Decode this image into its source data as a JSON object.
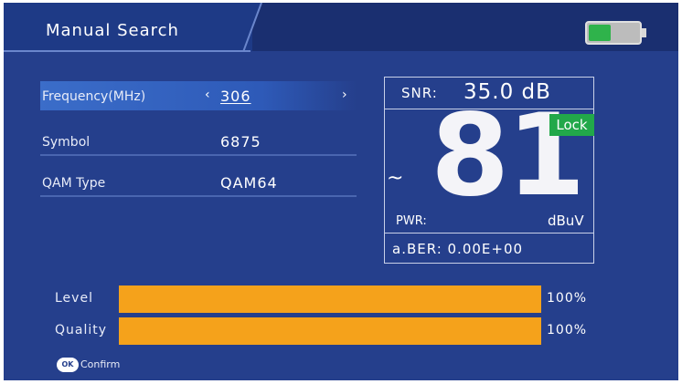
{
  "header": {
    "title": "Manual Search",
    "battery_level": 0.45,
    "battery_color": "#2fb34b"
  },
  "params": [
    {
      "label": "Frequency(MHz)",
      "value": "306",
      "left_arrow": "‹",
      "right_arrow": "›"
    },
    {
      "label": "Symbol",
      "value": "6875"
    },
    {
      "label": "QAM Type",
      "value": "QAM64"
    }
  ],
  "signal": {
    "snr_label": "SNR:",
    "snr_value": "35.0 dB",
    "lock": "Lock",
    "level": "81",
    "tilde": "~",
    "pwr_label": "PWR:",
    "pwr_unit": "dBuV",
    "ber": "a.BER: 0.00E+00"
  },
  "meters": [
    {
      "label": "Level",
      "percent": 100,
      "text": "100%"
    },
    {
      "label": "Quality",
      "percent": 100,
      "text": "100%"
    }
  ],
  "footer": {
    "ok_icon": "OK",
    "confirm": "Confirm"
  },
  "colors": {
    "background": "#253f8c",
    "bar": "#f5a21b",
    "lock": "#22a84a"
  }
}
